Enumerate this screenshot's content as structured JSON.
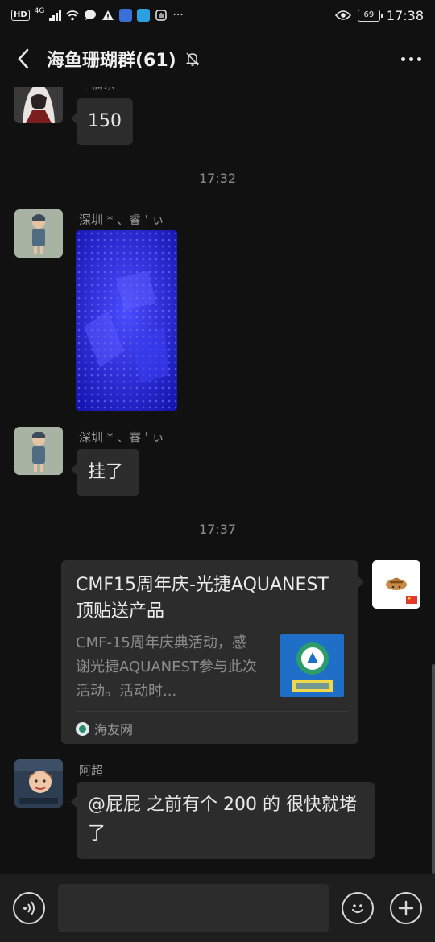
{
  "status_bar": {
    "hd_badge": "HD",
    "network": "4G",
    "battery": "69",
    "time": "17:38"
  },
  "header": {
    "title": "海鱼珊瑚群(61)"
  },
  "messages": [
    {
      "sender": "牟楠东",
      "text": "150"
    },
    {
      "time": "17:32"
    },
    {
      "sender": "深圳 * 、睿 ' ぃ",
      "type": "image"
    },
    {
      "sender": "深圳 * 、睿 ' ぃ",
      "text": "挂了"
    },
    {
      "time": "17:37"
    },
    {
      "type": "link_card",
      "title": "CMF15周年庆-光捷AQUANEST顶贴送产品",
      "description": "CMF-15周年庆典活动，感谢光捷AQUANEST参与此次活动。活动时...",
      "source": "海友网"
    },
    {
      "sender": "阿超",
      "text": "@屁屁 之前有个 200 的 很快就堵了"
    }
  ],
  "input_bar": {
    "placeholder": ""
  },
  "colors": {
    "background": "#111111",
    "bubble": "#2c2c2c",
    "input_bar": "#1e1e1e",
    "photo_blue": "#2a2bd8"
  }
}
